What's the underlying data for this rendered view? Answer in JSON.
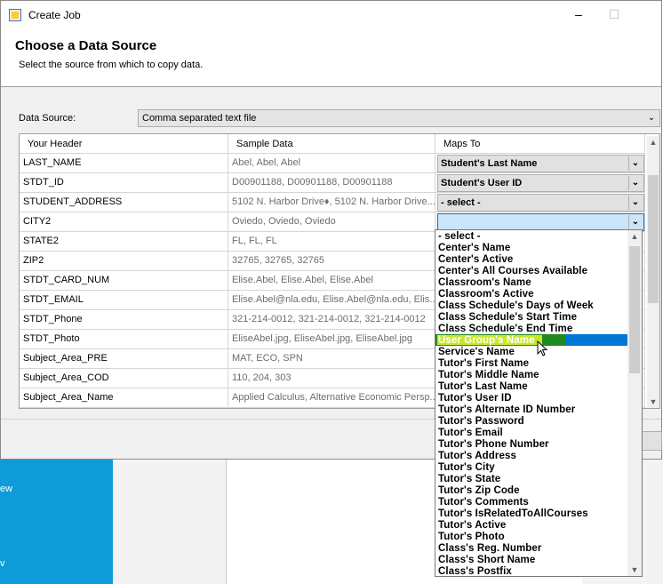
{
  "window": {
    "title": "Create Job",
    "minimize_icon": "minimize-icon",
    "maximize_icon": "maximize-icon"
  },
  "header": {
    "title": "Choose a Data Source",
    "subtitle": "Select the source from which to copy data."
  },
  "data_source": {
    "label": "Data Source:",
    "value": "Comma separated text file"
  },
  "grid": {
    "columns": [
      "Your Header",
      "Sample Data",
      "Maps To"
    ],
    "rows": [
      {
        "header": "LAST_NAME",
        "sample": "Abel, Abel, Abel",
        "maps_to": "Student's Last Name"
      },
      {
        "header": "STDT_ID",
        "sample": "D00901188, D00901188, D00901188",
        "maps_to": "Student's User ID"
      },
      {
        "header": "STUDENT_ADDRESS",
        "sample": "5102 N. Harbor Drive\u0000, 5102 N. Harbor Drive...",
        "maps_to": "- select -"
      },
      {
        "header": "CITY2",
        "sample": "Oviedo, Oviedo, Oviedo",
        "maps_to": ""
      },
      {
        "header": "STATE2",
        "sample": "FL, FL, FL",
        "maps_to": ""
      },
      {
        "header": "ZIP2",
        "sample": "32765, 32765, 32765",
        "maps_to": ""
      },
      {
        "header": "STDT_CARD_NUM",
        "sample": "Elise.Abel, Elise.Abel, Elise.Abel",
        "maps_to": ""
      },
      {
        "header": "STDT_EMAIL",
        "sample": "Elise.Abel@nla.edu, Elise.Abel@nla.edu, Elis...",
        "maps_to": ""
      },
      {
        "header": "STDT_Phone",
        "sample": "321-214-0012, 321-214-0012, 321-214-0012",
        "maps_to": ""
      },
      {
        "header": "STDT_Photo",
        "sample": "EliseAbel.jpg, EliseAbel.jpg, EliseAbel.jpg",
        "maps_to": ""
      },
      {
        "header": "Subject_Area_PRE",
        "sample": "MAT, ECO, SPN",
        "maps_to": ""
      },
      {
        "header": "Subject_Area_COD",
        "sample": "110, 204, 303",
        "maps_to": ""
      },
      {
        "header": "Subject_Area_Name",
        "sample": "Applied Calculus, Alternative Economic Persp...",
        "maps_to": ""
      }
    ]
  },
  "dropdown": {
    "selected": "User Group's Name",
    "items": [
      "- select -",
      "Center's Name",
      "Center's Active",
      "Center's All Courses Available",
      "Classroom's Name",
      "Classroom's Active",
      "Class Schedule's Days of Week",
      "Class Schedule's Start Time",
      "Class Schedule's End Time",
      "User Group's Name",
      "Service's Name",
      "Tutor's First Name",
      "Tutor's Middle Name",
      "Tutor's Last Name",
      "Tutor's User ID",
      "Tutor's Alternate ID Number",
      "Tutor's Password",
      "Tutor's Email",
      "Tutor's Phone Number",
      "Tutor's Address",
      "Tutor's City",
      "Tutor's State",
      "Tutor's Zip Code",
      "Tutor's Comments",
      "Tutor's IsRelatedToAllCourses",
      "Tutor's Active",
      "Tutor's Photo",
      "Class's Reg. Number",
      "Class's Short Name",
      "Class's Postfix"
    ]
  },
  "background": {
    "text1": "ew",
    "text2": "v"
  },
  "colors": {
    "selection_blue": "#0078d7",
    "highlight_green": "#1f8a1f",
    "highlight_yellow": "#c9e82c",
    "desktop_blue": "#0f9bd7"
  }
}
